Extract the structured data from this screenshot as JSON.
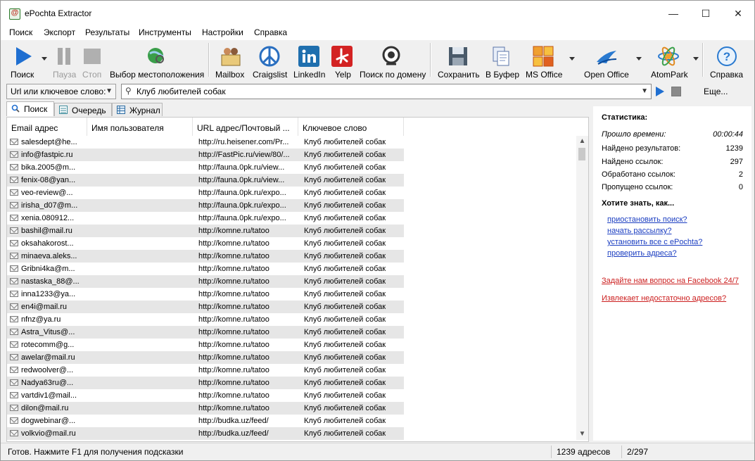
{
  "window": {
    "title": "ePochta Extractor",
    "minimize": "—",
    "maximize": "☐",
    "close": "✕"
  },
  "menu": [
    "Поиск",
    "Экспорт",
    "Результаты",
    "Инструменты",
    "Настройки",
    "Справка"
  ],
  "toolbar": {
    "search": "Поиск",
    "pause": "Пауза",
    "stop": "Стоп",
    "location": "Выбор местоположения",
    "mailbox": "Mailbox",
    "craigslist": "Craigslist",
    "linkedin": "LinkedIn",
    "yelp": "Yelp",
    "domain_search": "Поиск по домену",
    "save": "Сохранить",
    "clipboard": "В Буфер",
    "ms_office": "MS Office",
    "open_office": "Open Office",
    "atompark": "AtomPark",
    "help": "Справка"
  },
  "search_bar": {
    "mode": "Url или ключевое слово:",
    "query": "Клуб любителей собак",
    "more": "Еще..."
  },
  "tabs": [
    "Поиск",
    "Очередь",
    "Журнал"
  ],
  "columns": [
    "Email адрес",
    "Имя пользователя",
    "URL адрес/Почтовый ...",
    "Ключевое слово"
  ],
  "rows": [
    {
      "email": "salesdept@he...",
      "user": "",
      "url": "http://ru.heisener.com/Pr...",
      "kw": "Клуб любителей собак"
    },
    {
      "email": "info@fastpic.ru",
      "user": "",
      "url": "http://FastPic.ru/view/80/...",
      "kw": "Клуб любителей собак"
    },
    {
      "email": "bika.2005@m...",
      "user": "",
      "url": "http://fauna.0pk.ru/view...",
      "kw": "Клуб любителей собак"
    },
    {
      "email": "fenix-08@yan...",
      "user": "",
      "url": "http://fauna.0pk.ru/view...",
      "kw": "Клуб любителей собак"
    },
    {
      "email": "veo-review@...",
      "user": "",
      "url": "http://fauna.0pk.ru/expo...",
      "kw": "Клуб любителей собак"
    },
    {
      "email": "irisha_d07@m...",
      "user": "",
      "url": "http://fauna.0pk.ru/expo...",
      "kw": "Клуб любителей собак"
    },
    {
      "email": "xenia.080912...",
      "user": "",
      "url": "http://fauna.0pk.ru/expo...",
      "kw": "Клуб любителей собак"
    },
    {
      "email": "bashil@mail.ru",
      "user": "",
      "url": "http://komne.ru/tatoo",
      "kw": "Клуб любителей собак"
    },
    {
      "email": "oksahakorost...",
      "user": "",
      "url": "http://komne.ru/tatoo",
      "kw": "Клуб любителей собак"
    },
    {
      "email": "minaeva.aleks...",
      "user": "",
      "url": "http://komne.ru/tatoo",
      "kw": "Клуб любителей собак"
    },
    {
      "email": "Gribni4ka@m...",
      "user": "",
      "url": "http://komne.ru/tatoo",
      "kw": "Клуб любителей собак"
    },
    {
      "email": "nastaska_88@...",
      "user": "",
      "url": "http://komne.ru/tatoo",
      "kw": "Клуб любителей собак"
    },
    {
      "email": "inna1233@ya...",
      "user": "",
      "url": "http://komne.ru/tatoo",
      "kw": "Клуб любителей собак"
    },
    {
      "email": "en4i@mail.ru",
      "user": "",
      "url": "http://komne.ru/tatoo",
      "kw": "Клуб любителей собак"
    },
    {
      "email": "nfnz@ya.ru",
      "user": "",
      "url": "http://komne.ru/tatoo",
      "kw": "Клуб любителей собак"
    },
    {
      "email": "Astra_Vitus@...",
      "user": "",
      "url": "http://komne.ru/tatoo",
      "kw": "Клуб любителей собак"
    },
    {
      "email": "rotecomm@g...",
      "user": "",
      "url": "http://komne.ru/tatoo",
      "kw": "Клуб любителей собак"
    },
    {
      "email": "awelar@mail.ru",
      "user": "",
      "url": "http://komne.ru/tatoo",
      "kw": "Клуб любителей собак"
    },
    {
      "email": "redwoolver@...",
      "user": "",
      "url": "http://komne.ru/tatoo",
      "kw": "Клуб любителей собак"
    },
    {
      "email": "Nadya63ru@...",
      "user": "",
      "url": "http://komne.ru/tatoo",
      "kw": "Клуб любителей собак"
    },
    {
      "email": "vartdiv1@mail...",
      "user": "",
      "url": "http://komne.ru/tatoo",
      "kw": "Клуб любителей собак"
    },
    {
      "email": "dilon@mail.ru",
      "user": "",
      "url": "http://komne.ru/tatoo",
      "kw": "Клуб любителей собак"
    },
    {
      "email": "dogwebinar@...",
      "user": "",
      "url": "http://budka.uz/feed/",
      "kw": "Клуб любителей собак"
    },
    {
      "email": "volkvio@mail.ru",
      "user": "",
      "url": "http://budka.uz/feed/",
      "kw": "Клуб любителей собак"
    }
  ],
  "stats": {
    "title": "Статистика:",
    "items": [
      {
        "label": "Прошло времени:",
        "value": "00:00:44"
      },
      {
        "label": "Найдено результатов:",
        "value": "1239"
      },
      {
        "label": "Найдено ссылок:",
        "value": "297"
      },
      {
        "label": "Обработано ссылок:",
        "value": "2"
      },
      {
        "label": "Пропущено ссылок:",
        "value": "0"
      }
    ],
    "howto_title": "Хотите знать, как...",
    "links": [
      "приостановить поиск?",
      "начать рассылку?",
      "установить все с ePochta?",
      "проверить адреса?"
    ],
    "facebook": "Задайте нам вопрос на Facebook 24/7",
    "too_few": "Извлекает недостаточно адресов?"
  },
  "status": {
    "hint": "Готов. Нажмите F1 для получения подсказки",
    "count": "1239 адресов",
    "progress": "2/297"
  }
}
